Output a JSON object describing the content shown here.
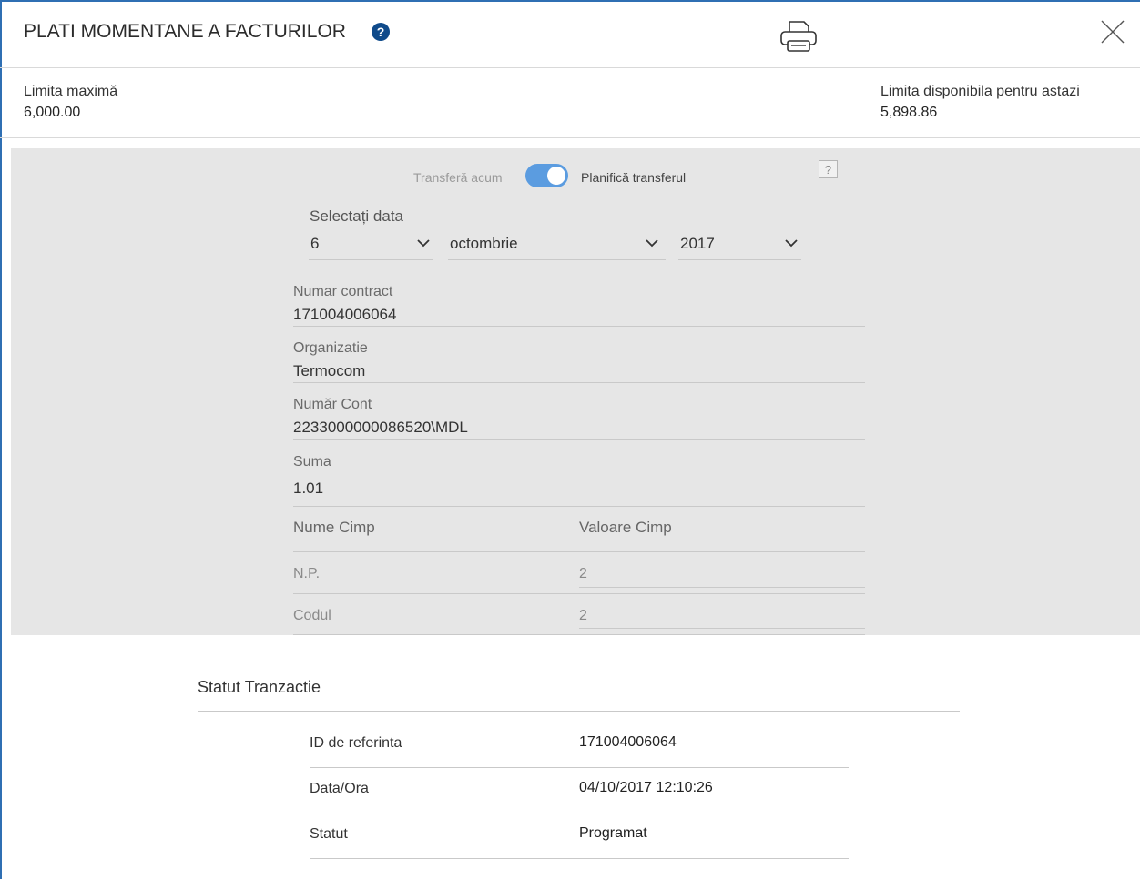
{
  "header": {
    "title": "PLATI MOMENTANE A FACTURILOR",
    "help_label": "?",
    "print_icon": "printer-icon",
    "close_icon": "close-icon"
  },
  "limits": {
    "max_label": "Limita maximă",
    "max_value": "6,000.00",
    "available_label": "Limita disponibila pentru astazi",
    "available_value": "5,898.86"
  },
  "transfer": {
    "now_label": "Transferă acum",
    "plan_label": "Planifică transferul",
    "toggle_on": true,
    "help_label": "?"
  },
  "date": {
    "label": "Selectați data",
    "day": "6",
    "month": "octombrie",
    "year": "2017"
  },
  "fields": {
    "contract_label": "Numar contract",
    "contract_value": "171004006064",
    "org_label": "Organizatie",
    "org_value": "Termocom",
    "account_label": "Număr Cont",
    "account_value": "2233000000086520\\MDL",
    "sum_label": "Suma",
    "sum_value": "1.01"
  },
  "custom_fields": {
    "col_name": "Nume Cimp",
    "col_value": "Valoare Cimp",
    "rows": [
      {
        "name": "N.P.",
        "value": "2"
      },
      {
        "name": "Codul",
        "value": "2"
      }
    ]
  },
  "status": {
    "title": "Statut Tranzactie",
    "rows": [
      {
        "label": "ID de referinta",
        "value": "171004006064"
      },
      {
        "label": "Data/Ora",
        "value": "04/10/2017 12:10:26"
      },
      {
        "label": "Statut",
        "value": "Programat"
      }
    ]
  },
  "colors": {
    "accent": "#2f6fb3",
    "toggle": "#5b9ce0",
    "help_badge": "#0f4a8a",
    "panel_bg": "#e6e6e6"
  }
}
